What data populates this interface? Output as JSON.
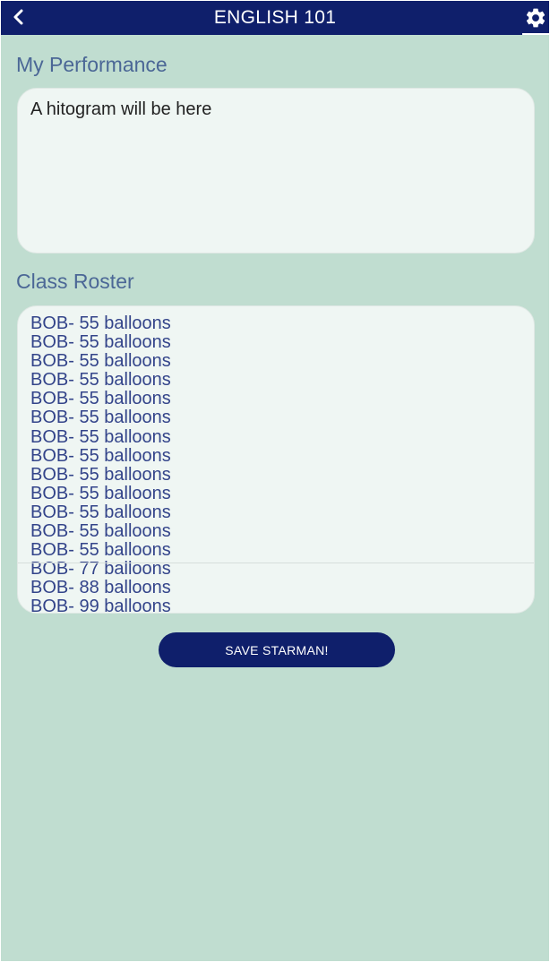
{
  "header": {
    "title": "ENGLISH 101",
    "back_icon": "chevron-left-icon",
    "settings_icon": "gear-icon"
  },
  "performance": {
    "heading": "My Performance",
    "placeholder_text": "A hitogram will be here"
  },
  "roster": {
    "heading": "Class Roster",
    "items": [
      "BOB- 55 balloons",
      "BOB- 55 balloons",
      "BOB- 55 balloons",
      "BOB- 55 balloons",
      "BOB- 55 balloons",
      "BOB- 55 balloons",
      "BOB- 55 balloons",
      "BOB- 55 balloons",
      "BOB- 55 balloons",
      "BOB- 55 balloons",
      "BOB- 55 balloons",
      "BOB- 55 balloons",
      "BOB- 55 balloons",
      "BOB- 77 balloons",
      "BOB- 88 balloons",
      "BOB- 99 balloons"
    ]
  },
  "actions": {
    "save_label": "SAVE STARMAN!"
  },
  "colors": {
    "header_bg": "#0f1f6b",
    "page_bg": "#c0ddd0",
    "card_bg": "#eff6f3",
    "heading_text": "#4b6796",
    "roster_text": "#33448a"
  }
}
